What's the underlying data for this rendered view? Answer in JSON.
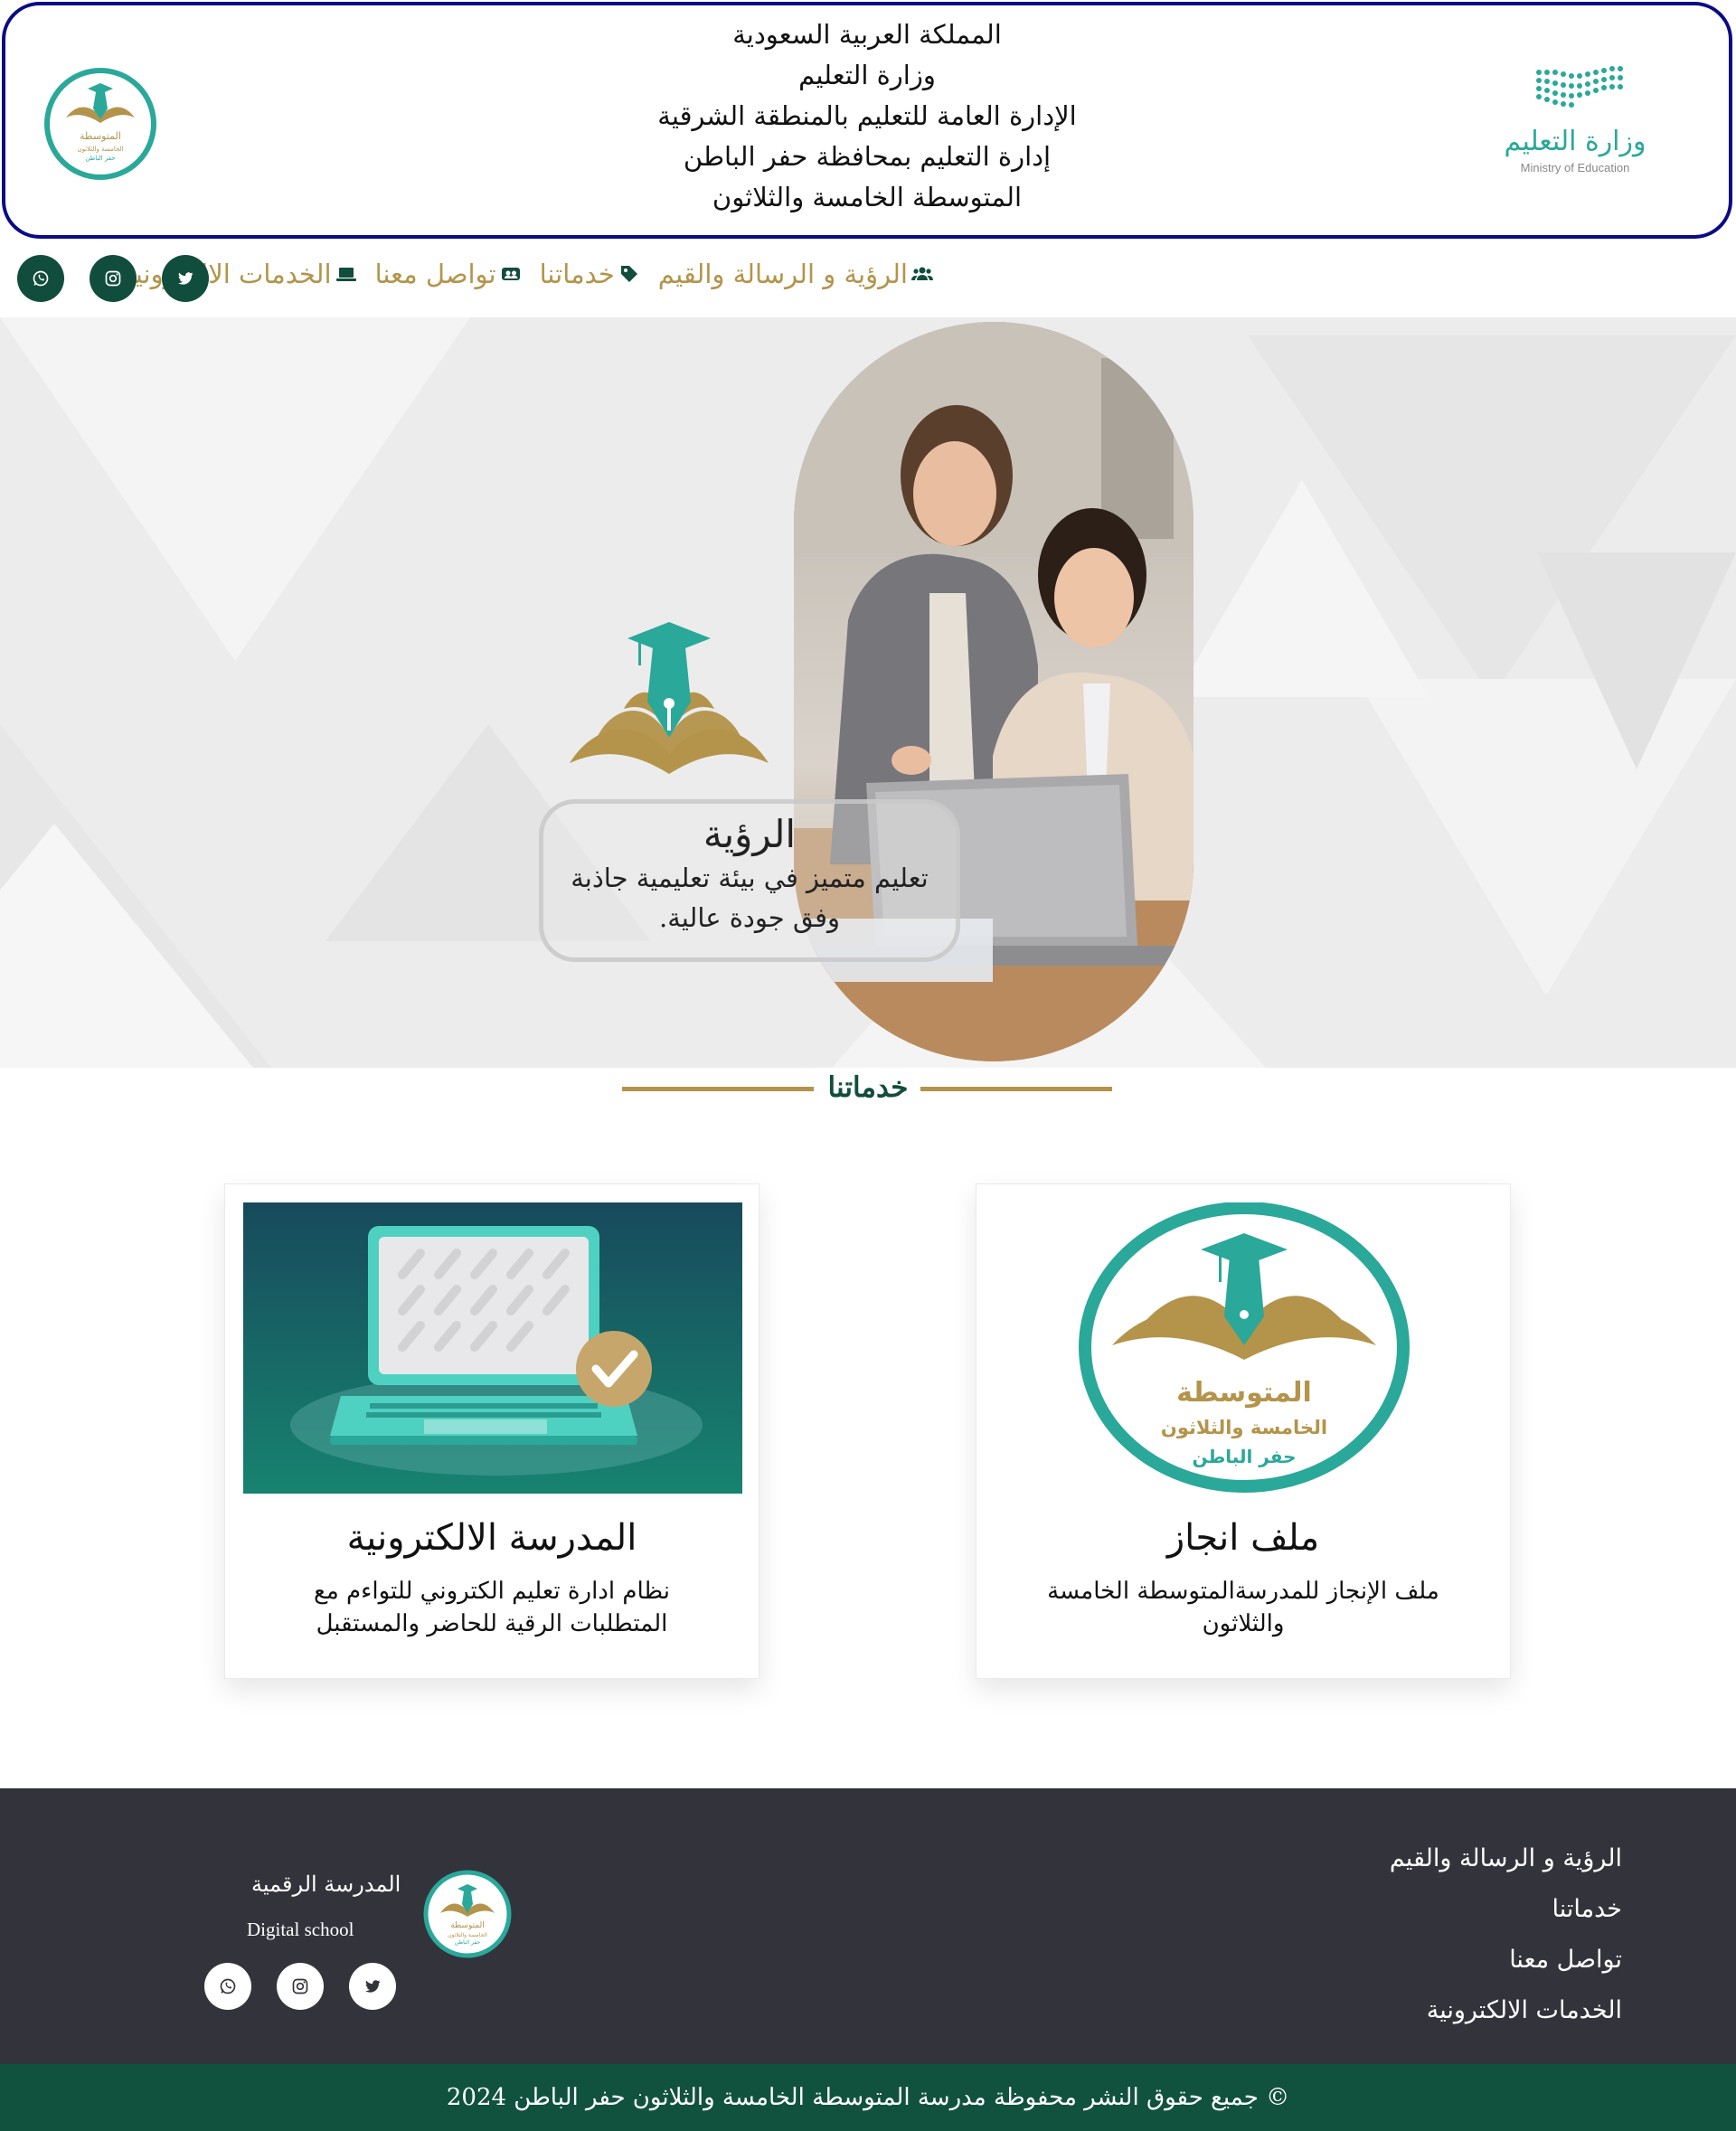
{
  "header": {
    "lines": [
      "المملكة العربية السعودية",
      "وزارة التعليم",
      "الإدارة العامة للتعليم بالمنطقة الشرقية",
      "إدارة التعليم بمحافظة حفر الباطن",
      "المتوسطة الخامسة والثلاثون"
    ],
    "moe_logo_ar": "وزارة التعليم",
    "moe_logo_en": "Ministry of Education"
  },
  "school_logo": {
    "line1": "المتوسطة",
    "line2": "الخامسة والثلاثون",
    "line3": "حفر الباطن"
  },
  "nav": {
    "items": [
      {
        "label": "الرؤية و الرسالة والقيم",
        "icon": "users-icon"
      },
      {
        "label": "خدماتنا",
        "icon": "tag-icon"
      },
      {
        "label": "تواصل معنا",
        "icon": "contact-icon"
      },
      {
        "label": "الخدمات الالكترونيه",
        "icon": "laptop-icon"
      }
    ],
    "social": [
      "twitter-icon",
      "instagram-icon",
      "whatsapp-icon"
    ]
  },
  "hero": {
    "vision_title": "الرؤية",
    "vision_text": "تعليم متميز في بيئة تعليمية جاذبة وفق جودة عالية."
  },
  "services": {
    "title": "خدماتنا",
    "cards": [
      {
        "title": "ملف انجاز",
        "desc": "ملف الإنجاز للمدرسةالمتوسطة الخامسة والثلاثون"
      },
      {
        "title": "المدرسة الالكترونية",
        "desc": "نظام ادارة تعليم الكتروني للتواءم مع المتطلبات الرقية للحاضر والمستقبل"
      }
    ]
  },
  "footer": {
    "links": [
      "الرؤية و الرسالة والقيم",
      "خدماتنا",
      "تواصل معنا",
      "الخدمات الالكترونية"
    ],
    "brand_ar": "المدرسة الرقمية",
    "brand_en": "Digital school",
    "copyright": "© جميع حقوق النشر محفوظة مدرسة المتوسطة الخامسة والثلاثون حفر الباطن 2024"
  },
  "colors": {
    "navy_border": "#0b0b86",
    "gold": "#b3944a",
    "dark_green": "#114d3c",
    "teal": "#2aa89a",
    "footer_bg": "#33333b",
    "copyright_bg": "#11523f"
  }
}
